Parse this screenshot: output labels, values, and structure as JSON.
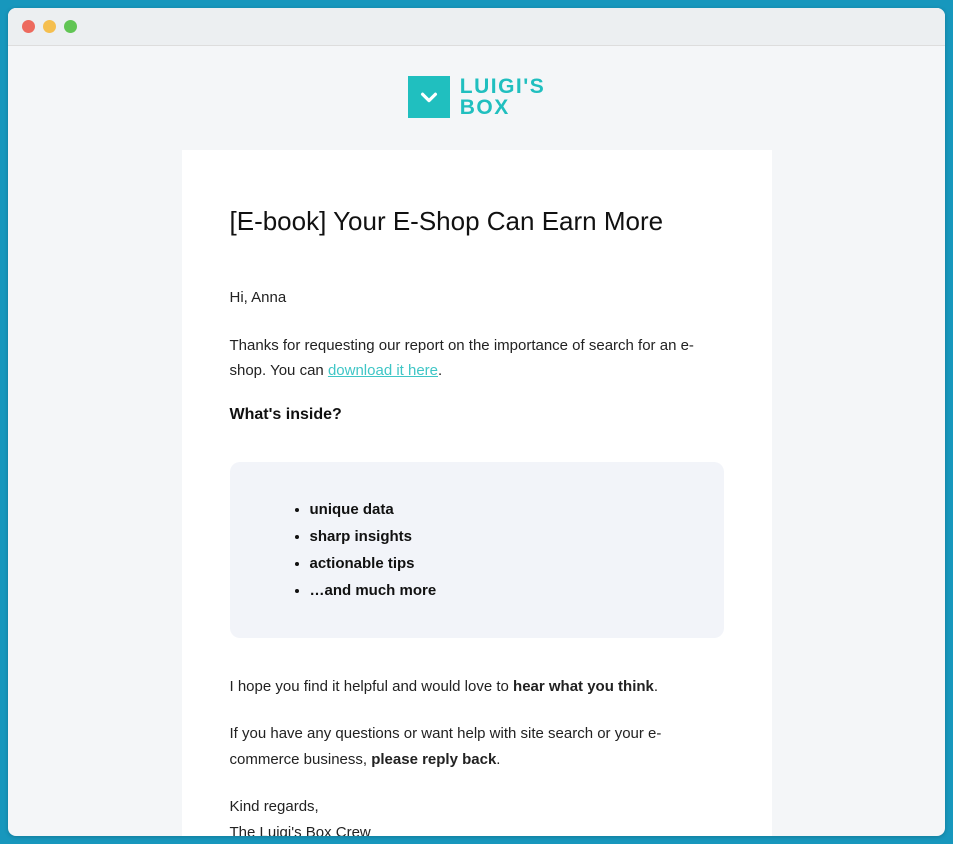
{
  "logo": {
    "line1": "LUIGI'S",
    "line2": "BOX"
  },
  "email": {
    "title": "[E-book] Your E-Shop Can Earn More",
    "greeting": "Hi, Anna",
    "intro_prefix": "Thanks for requesting our report on the importance of search for an e-shop. You can ",
    "download_link_text": "download it here",
    "intro_suffix": ".",
    "subheading": "What's inside?",
    "features": [
      "unique data",
      "sharp insights",
      "actionable tips",
      "…and much more"
    ],
    "hope_prefix": "I hope you find it helpful and would love to ",
    "hope_bold": "hear what you think",
    "hope_suffix": ".",
    "help_prefix": "If you have any questions or want help with site search or your e-commerce business, ",
    "help_bold": "please reply back",
    "help_suffix": ".",
    "signoff1": "Kind regards,",
    "signoff2": "The Luigi's Box Crew"
  }
}
